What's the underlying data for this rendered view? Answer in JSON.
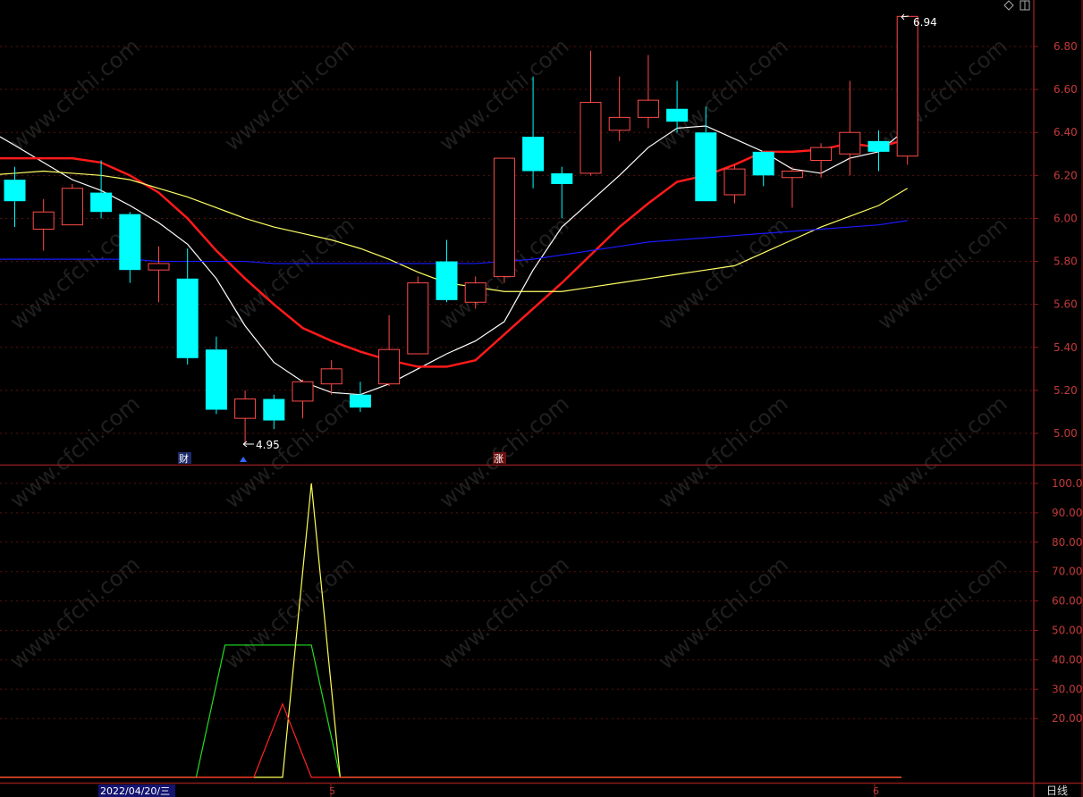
{
  "toolbar": {
    "diamond_icon": "diamond-icon",
    "panel_icon": "panel-toggle-icon"
  },
  "colors": {
    "background": "#000000",
    "frame": "#8b1c1c",
    "grid": "#5a1010",
    "axis_text": "#c23a3a",
    "up": "#ff4a4a",
    "down": "#00ffff",
    "ma5": "#ffffff",
    "ma10": "#ff1a1a",
    "ma20": "#ffff66",
    "ma60": "#1a1aff",
    "ind_green": "#22dd22",
    "ind_yellow": "#ffff55",
    "ind_red": "#ff2222",
    "annot_text": "#ffffff"
  },
  "footer": {
    "date_label": "2022/04/20/三",
    "month_5": "5",
    "month_6": "6",
    "period_label": "日线"
  },
  "markers": {
    "cai": "财",
    "zhang": "涨"
  },
  "chart_data": [
    {
      "type": "candlestick",
      "ylim": [
        4.87,
        7.0
      ],
      "yticks": [
        "5.00",
        "5.20",
        "5.40",
        "5.60",
        "5.80",
        "6.00",
        "6.20",
        "6.40",
        "6.60",
        "6.80"
      ],
      "annotations": {
        "low": "4.95",
        "high": "6.94"
      },
      "candles": [
        {
          "o": 6.18,
          "c": 6.08,
          "h": 6.24,
          "l": 5.96
        },
        {
          "o": 5.95,
          "c": 6.03,
          "h": 6.09,
          "l": 5.85
        },
        {
          "o": 5.97,
          "c": 6.14,
          "h": 6.16,
          "l": 5.97
        },
        {
          "o": 6.12,
          "c": 6.03,
          "h": 6.27,
          "l": 6.0
        },
        {
          "o": 6.02,
          "c": 5.76,
          "h": 6.03,
          "l": 5.7
        },
        {
          "o": 5.76,
          "c": 5.79,
          "h": 5.87,
          "l": 5.61
        },
        {
          "o": 5.72,
          "c": 5.35,
          "h": 5.86,
          "l": 5.32
        },
        {
          "o": 5.39,
          "c": 5.11,
          "h": 5.45,
          "l": 5.09
        },
        {
          "o": 5.07,
          "c": 5.16,
          "h": 5.2,
          "l": 4.95
        },
        {
          "o": 5.16,
          "c": 5.06,
          "h": 5.18,
          "l": 5.02
        },
        {
          "o": 5.15,
          "c": 5.24,
          "h": 5.25,
          "l": 5.07
        },
        {
          "o": 5.23,
          "c": 5.3,
          "h": 5.34,
          "l": 5.18
        },
        {
          "o": 5.18,
          "c": 5.12,
          "h": 5.24,
          "l": 5.1
        },
        {
          "o": 5.23,
          "c": 5.39,
          "h": 5.55,
          "l": 5.22
        },
        {
          "o": 5.37,
          "c": 5.7,
          "h": 5.73,
          "l": 5.37
        },
        {
          "o": 5.8,
          "c": 5.62,
          "h": 5.9,
          "l": 5.61
        },
        {
          "o": 5.61,
          "c": 5.7,
          "h": 5.73,
          "l": 5.58
        },
        {
          "o": 5.73,
          "c": 6.28,
          "h": 6.28,
          "l": 5.7
        },
        {
          "o": 6.38,
          "c": 6.22,
          "h": 6.66,
          "l": 6.14
        },
        {
          "o": 6.21,
          "c": 6.16,
          "h": 6.24,
          "l": 6.0
        },
        {
          "o": 6.21,
          "c": 6.54,
          "h": 6.78,
          "l": 6.2
        },
        {
          "o": 6.41,
          "c": 6.47,
          "h": 6.66,
          "l": 6.36
        },
        {
          "o": 6.47,
          "c": 6.55,
          "h": 6.76,
          "l": 6.42
        },
        {
          "o": 6.51,
          "c": 6.45,
          "h": 6.64,
          "l": 6.4
        },
        {
          "o": 6.4,
          "c": 6.08,
          "h": 6.52,
          "l": 6.08
        },
        {
          "o": 6.11,
          "c": 6.23,
          "h": 6.25,
          "l": 6.07
        },
        {
          "o": 6.31,
          "c": 6.2,
          "h": 6.31,
          "l": 6.15
        },
        {
          "o": 6.19,
          "c": 6.22,
          "h": 6.24,
          "l": 6.05
        },
        {
          "o": 6.27,
          "c": 6.33,
          "h": 6.35,
          "l": 6.19
        },
        {
          "o": 6.3,
          "c": 6.4,
          "h": 6.64,
          "l": 6.2
        },
        {
          "o": 6.36,
          "c": 6.31,
          "h": 6.41,
          "l": 6.22
        },
        {
          "o": 6.29,
          "c": 6.94,
          "h": 6.94,
          "l": 6.25
        }
      ],
      "ma": [
        {
          "color_key": "ma5",
          "values": [
            6.34,
            6.26,
            6.18,
            6.13,
            6.06,
            5.98,
            5.88,
            5.72,
            5.5,
            5.33,
            5.24,
            5.19,
            5.18,
            5.23,
            5.3,
            5.37,
            5.43,
            5.52,
            5.76,
            5.96,
            6.08,
            6.2,
            6.33,
            6.42,
            6.43,
            6.37,
            6.31,
            6.23,
            6.21,
            6.28,
            6.31,
            6.42
          ]
        },
        {
          "color_key": "ma10",
          "values": [
            6.28,
            6.28,
            6.28,
            6.26,
            6.2,
            6.12,
            6.0,
            5.85,
            5.72,
            5.6,
            5.49,
            5.43,
            5.38,
            5.34,
            5.31,
            5.31,
            5.34,
            5.46,
            5.58,
            5.7,
            5.83,
            5.96,
            6.07,
            6.17,
            6.2,
            6.25,
            6.31,
            6.31,
            6.32,
            6.35,
            6.33,
            6.37
          ]
        },
        {
          "color_key": "ma20",
          "values": [
            6.21,
            6.22,
            6.21,
            6.2,
            6.18,
            6.14,
            6.1,
            6.05,
            6.0,
            5.96,
            5.93,
            5.9,
            5.86,
            5.81,
            5.75,
            5.7,
            5.68,
            5.66,
            5.66,
            5.66,
            5.68,
            5.7,
            5.72,
            5.74,
            5.76,
            5.78,
            5.84,
            5.9,
            5.96,
            6.01,
            6.06,
            6.14
          ]
        },
        {
          "color_key": "ma60",
          "values": [
            5.81,
            5.81,
            5.81,
            5.81,
            5.81,
            5.8,
            5.8,
            5.8,
            5.8,
            5.79,
            5.79,
            5.79,
            5.79,
            5.79,
            5.79,
            5.79,
            5.79,
            5.8,
            5.81,
            5.83,
            5.85,
            5.87,
            5.89,
            5.9,
            5.91,
            5.92,
            5.93,
            5.94,
            5.95,
            5.96,
            5.97,
            5.99
          ]
        }
      ]
    },
    {
      "type": "line",
      "ylim": [
        0,
        108
      ],
      "yticks": [
        "20.00",
        "30.00",
        "40.00",
        "50.00",
        "60.00",
        "70.00",
        "80.00",
        "90.00",
        "100.0"
      ],
      "x": [
        0,
        6.3,
        7.3,
        9.3,
        10.3,
        11.3,
        31.5
      ],
      "series": [
        {
          "color_key": "ind_green",
          "points": [
            [
              0,
              0
            ],
            [
              6.3,
              0
            ],
            [
              7.3,
              45
            ],
            [
              10.3,
              45
            ],
            [
              11.3,
              0
            ],
            [
              31.5,
              0
            ]
          ]
        },
        {
          "color_key": "ind_yellow",
          "points": [
            [
              0,
              0
            ],
            [
              9.3,
              0
            ],
            [
              10.3,
              100
            ],
            [
              11.3,
              0
            ],
            [
              31.5,
              0
            ]
          ]
        },
        {
          "color_key": "ind_red",
          "points": [
            [
              0,
              0
            ],
            [
              8.3,
              0
            ],
            [
              9.3,
              25
            ],
            [
              10.3,
              0
            ],
            [
              31.5,
              0
            ]
          ]
        }
      ]
    }
  ]
}
